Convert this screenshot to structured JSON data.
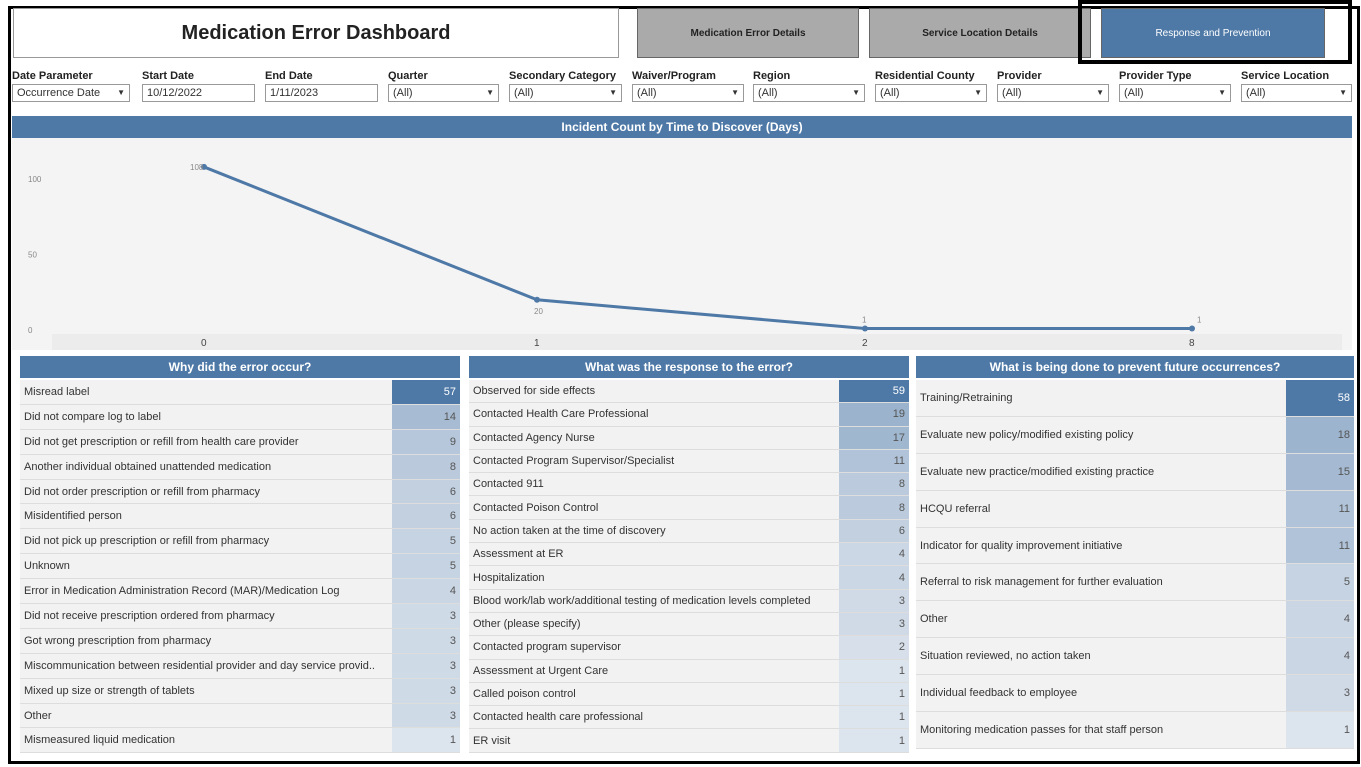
{
  "header": {
    "title": "Medication Error Dashboard",
    "nav": [
      {
        "label": "Medication Error Details"
      },
      {
        "label": "Service Location Details"
      },
      {
        "label": "Response and Prevention"
      }
    ]
  },
  "filters": [
    {
      "label": "Date Parameter",
      "value": "Occurrence Date",
      "dropdown": true
    },
    {
      "label": "Start Date",
      "value": "10/12/2022",
      "dropdown": false
    },
    {
      "label": "End Date",
      "value": "1/11/2023",
      "dropdown": false
    },
    {
      "label": "Quarter",
      "value": "(All)",
      "dropdown": true
    },
    {
      "label": "Secondary Category",
      "value": "(All)",
      "dropdown": true
    },
    {
      "label": "Waiver/Program",
      "value": "(All)",
      "dropdown": true
    },
    {
      "label": "Region",
      "value": "(All)",
      "dropdown": true
    },
    {
      "label": "Residential County",
      "value": "(All)",
      "dropdown": true
    },
    {
      "label": "Provider",
      "value": "(All)",
      "dropdown": true
    },
    {
      "label": "Provider Type",
      "value": "(All)",
      "dropdown": true
    },
    {
      "label": "Service Location",
      "value": "(All)",
      "dropdown": true
    }
  ],
  "chart_data": {
    "type": "line",
    "title": "Incident Count by Time to Discover (Days)",
    "categories": [
      "0",
      "1",
      "2",
      "8"
    ],
    "values": [
      108,
      20,
      1,
      1
    ],
    "yticks": [
      "0",
      "50",
      "100"
    ],
    "ylim": [
      0,
      110
    ],
    "color": "#4e79a7"
  },
  "panels": [
    {
      "title": "Why did the error occur?",
      "rows": [
        {
          "label": "Misread label",
          "value": "57"
        },
        {
          "label": "Did not compare log to label",
          "value": "14"
        },
        {
          "label": "Did not get prescription or refill from health care provider",
          "value": "9"
        },
        {
          "label": "Another individual obtained unattended medication",
          "value": "8"
        },
        {
          "label": "Did not order prescription or refill from pharmacy",
          "value": "6"
        },
        {
          "label": "Misidentified person",
          "value": "6"
        },
        {
          "label": "Did not pick up prescription or refill from pharmacy",
          "value": "5"
        },
        {
          "label": "Unknown",
          "value": "5"
        },
        {
          "label": "Error in Medication Administration Record (MAR)/Medication Log",
          "value": "4"
        },
        {
          "label": "Did not receive prescription ordered from pharmacy",
          "value": "3"
        },
        {
          "label": "Got wrong prescription from pharmacy",
          "value": "3"
        },
        {
          "label": "Miscommunication between residential provider and day service provid..",
          "value": "3"
        },
        {
          "label": "Mixed up size or strength of tablets",
          "value": "3"
        },
        {
          "label": "Other",
          "value": "3"
        },
        {
          "label": "Mismeasured liquid medication",
          "value": "1"
        }
      ]
    },
    {
      "title": "What was the response to the error?",
      "rows": [
        {
          "label": "Observed for side effects",
          "value": "59"
        },
        {
          "label": "Contacted Health Care Professional",
          "value": "19"
        },
        {
          "label": "Contacted Agency Nurse",
          "value": "17"
        },
        {
          "label": "Contacted Program Supervisor/Specialist",
          "value": "11"
        },
        {
          "label": "Contacted 911",
          "value": "8"
        },
        {
          "label": "Contacted Poison Control",
          "value": "8"
        },
        {
          "label": "No action taken at the time of discovery",
          "value": "6"
        },
        {
          "label": "Assessment at ER",
          "value": "4"
        },
        {
          "label": "Hospitalization",
          "value": "4"
        },
        {
          "label": "Blood work/lab work/additional testing of medication levels completed",
          "value": "3"
        },
        {
          "label": "Other (please specify)",
          "value": "3"
        },
        {
          "label": "Contacted program supervisor",
          "value": "2"
        },
        {
          "label": "Assessment at Urgent Care",
          "value": "1"
        },
        {
          "label": "Called poison control",
          "value": "1"
        },
        {
          "label": "Contacted health care professional",
          "value": "1"
        },
        {
          "label": "ER visit",
          "value": "1"
        }
      ]
    },
    {
      "title": "What is being done to prevent future occurrences?",
      "rows": [
        {
          "label": "Training/Retraining",
          "value": "58"
        },
        {
          "label": "Evaluate new policy/modified existing policy",
          "value": "18"
        },
        {
          "label": "Evaluate new practice/modified existing practice",
          "value": "15"
        },
        {
          "label": "HCQU referral",
          "value": "11"
        },
        {
          "label": "Indicator for quality improvement initiative",
          "value": "11"
        },
        {
          "label": "Referral to risk management for further evaluation",
          "value": "5"
        },
        {
          "label": "Other",
          "value": "4"
        },
        {
          "label": "Situation reviewed, no action taken",
          "value": "4"
        },
        {
          "label": "Individual feedback to employee",
          "value": "3"
        },
        {
          "label": "Monitoring medication passes for that staff person",
          "value": "1"
        }
      ]
    }
  ]
}
